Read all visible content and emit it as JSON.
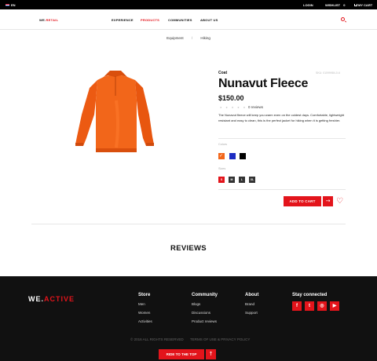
{
  "topbar": {
    "language": "EN",
    "login": "LOGIN",
    "wishlist": "WISHLIST",
    "wishlist_count": "0",
    "cart": "MY CART"
  },
  "nav": {
    "logo_prefix": "WE.",
    "logo_accent": "RETAIL",
    "items": [
      {
        "label": "EXPERIENCE"
      },
      {
        "label": "PRODUCTS"
      },
      {
        "label": "COMMUNITIES"
      },
      {
        "label": "ABOUT US"
      }
    ],
    "active_item": "PRODUCTS"
  },
  "breadcrumb": {
    "items": [
      "Equipment",
      "Hiking"
    ],
    "separator": "/"
  },
  "product": {
    "category": "Coat",
    "sku": "SKU: 01099984-0-6",
    "title": "Nunavut Fleece",
    "price": "$150.00",
    "rating": 0,
    "reviews_count": "0 reviews",
    "description": "The Nunavut fleece will keep you warm even on the coldest days. Comfortable, lightweight resistant and easy to clean, this is the perfect jacket for hiking when it is getting freshier.",
    "color_label": "Colors",
    "colors": [
      "#f2661a",
      "#1c2cc2",
      "#000000"
    ],
    "selected_color": "#f2661a",
    "size_label": "Sizes",
    "sizes": [
      "S",
      "M",
      "L",
      "XL"
    ],
    "selected_size": "S",
    "add_to_cart": "ADD TO CART"
  },
  "reviews_heading": "REVIEWS",
  "footer": {
    "logo_prefix": "WE.",
    "logo_accent": "ACTIVE",
    "columns": [
      {
        "title": "Store",
        "links": [
          "Men",
          "Women",
          "Activities"
        ]
      },
      {
        "title": "Community",
        "links": [
          "Blogs",
          "Discussions",
          "Product reviews"
        ]
      },
      {
        "title": "About",
        "links": [
          "Brand",
          "Support"
        ]
      }
    ],
    "social_title": "Stay connected",
    "social": [
      {
        "name": "facebook",
        "glyph": "f"
      },
      {
        "name": "twitter",
        "glyph": "t"
      },
      {
        "name": "instagram",
        "glyph": "◎"
      },
      {
        "name": "youtube",
        "glyph": "▶"
      }
    ],
    "copyright": "© 2016 ALL RIGHTS RESERVED",
    "terms": "TERMS OF USE & PRIVACY POLICY",
    "ride_to_top": "RIDE TO THE TOP"
  },
  "colors": {
    "accent": "#e3141b",
    "jacket": "#f2661a",
    "footer_bg": "#111111"
  }
}
